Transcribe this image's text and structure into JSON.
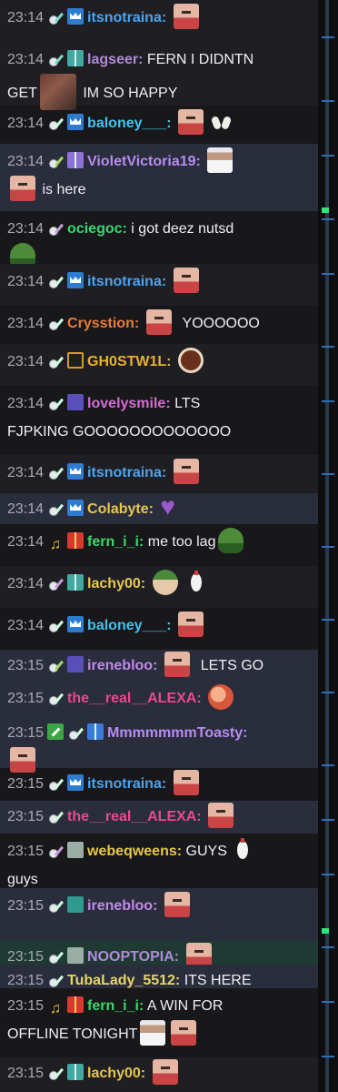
{
  "messages": [
    {
      "time": "23:14",
      "badges": [
        "guitar-teal",
        "crown"
      ],
      "name": "itsnotraina",
      "color": "#4aa3f0",
      "text": "",
      "emotes_after": [
        "face"
      ],
      "style": "alt"
    },
    {
      "time": "23:14",
      "badges": [
        "guitar-teal",
        "gift-teal"
      ],
      "name": "lagseer",
      "color": "#b08bd8",
      "text": "FERN I DIDNTN",
      "line2_pre": "GET",
      "line2_emote": "photo",
      "line2_post": "IM SO HAPPY",
      "style": "alt"
    },
    {
      "time": "23:14",
      "badges": [
        "guitar",
        "crown"
      ],
      "name": "baloney___",
      "color": "#42c2f0",
      "text": "",
      "emotes_after": [
        "face",
        "hands"
      ],
      "style": "plain"
    },
    {
      "time": "23:14",
      "badges": [
        "guitar-green",
        "gift-purple"
      ],
      "name": "VioletVictoria19",
      "color": "#b68cf0",
      "text": "",
      "emotes_after": [
        "person"
      ],
      "line2_emote": "face",
      "line2_post": "is here",
      "style": "hl"
    },
    {
      "time": "23:14",
      "badges": [
        "guitar-purple"
      ],
      "name": "ociegoc",
      "color": "#36d86f",
      "text": "i got deez nutsd",
      "line2_emote": "frog",
      "style": "plain"
    },
    {
      "time": "23:14",
      "badges": [
        "guitar",
        "crown"
      ],
      "name": "itsnotraina",
      "color": "#4aa3f0",
      "text": "",
      "emotes_after": [
        "face"
      ],
      "style": "alt"
    },
    {
      "time": "23:14",
      "badges": [
        "guitar"
      ],
      "name": "Crysstion",
      "color": "#e87a3a",
      "text": "YOOOOOO",
      "emotes_before_text": [
        "face"
      ],
      "style": "plain"
    },
    {
      "time": "23:14",
      "badges": [
        "guitar",
        "tilde"
      ],
      "name": "GH0STW1L",
      "color": "#e6b030",
      "text": "",
      "emotes_after": [
        "cookie"
      ],
      "style": "alt"
    },
    {
      "time": "23:14",
      "badges": [
        "guitar",
        "f-purple"
      ],
      "name": "lovelysmile",
      "color": "#d66bd6",
      "text": "LTS",
      "line2_pre": "FJPKING GOOOOOOOOOOOOO",
      "style": "plain"
    },
    {
      "time": "23:14",
      "badges": [
        "guitar",
        "crown"
      ],
      "name": "itsnotraina",
      "color": "#4aa3f0",
      "text": "",
      "emotes_after": [
        "face"
      ],
      "style": "alt"
    },
    {
      "time": "23:14",
      "badges": [
        "guitar",
        "crown"
      ],
      "name": "Colabyte",
      "color": "#e6c650",
      "text": "",
      "emotes_after": [
        "purpleheart"
      ],
      "style": "hl"
    },
    {
      "time": "23:14",
      "badges": [
        "note",
        "gift-red"
      ],
      "name": "fern_i_i",
      "color": "#3fd46a",
      "text": "me too lag",
      "emotes_after": [
        "frog"
      ],
      "style": "plain"
    },
    {
      "time": "23:14",
      "badges": [
        "guitar-purple",
        "gift-teal"
      ],
      "name": "lachy00",
      "color": "#e6c650",
      "text": "",
      "emotes_after": [
        "knight",
        "chicken"
      ],
      "style": "alt"
    },
    {
      "time": "23:14",
      "badges": [
        "guitar",
        "crown"
      ],
      "name": "baloney___",
      "color": "#42c2f0",
      "text": "",
      "emotes_after": [
        "face"
      ],
      "style": "plain"
    },
    {
      "time": "23:15",
      "badges": [
        "guitar-green",
        "f-purple"
      ],
      "name": "irenebloo",
      "color": "#c08ae8",
      "text": "LETS GO",
      "emotes_before_text": [
        "face"
      ],
      "style": "hl"
    },
    {
      "time": "23:15",
      "badges": [
        "guitar"
      ],
      "name": "the__real__ALEXA",
      "color": "#e84a8a",
      "text": "",
      "emotes_after": [
        "hug"
      ],
      "style": "hl"
    },
    {
      "time": "23:15",
      "badges": [
        "sword",
        "guitar",
        "gift-blue"
      ],
      "name": "MmmmmmmToasty",
      "color": "#b68cf0",
      "text": "",
      "line2_emote": "face",
      "style": "hl"
    },
    {
      "time": "23:15",
      "badges": [
        "guitar",
        "crown"
      ],
      "name": "itsnotraina",
      "color": "#4aa3f0",
      "text": "",
      "emotes_after": [
        "face"
      ],
      "style": "plain"
    },
    {
      "time": "23:15",
      "badges": [
        "guitar"
      ],
      "name": "the__real__ALEXA",
      "color": "#e84a8a",
      "text": "",
      "emotes_after": [
        "face"
      ],
      "style": "hl"
    },
    {
      "time": "23:15",
      "badges": [
        "guitar-purple",
        "cash"
      ],
      "name": "webeqweens",
      "color": "#e6c650",
      "text": "GUYS",
      "emotes_after": [
        "chicken"
      ],
      "line2_pre": "guys",
      "style": "plain"
    },
    {
      "time": "23:15",
      "badges": [
        "guitar",
        "f-teal"
      ],
      "name": "irenebloo",
      "color": "#c08ae8",
      "text": "",
      "emotes_after": [
        "face"
      ],
      "style": "hl"
    },
    {
      "time": "23:15",
      "badges": [
        "guitar",
        "cash"
      ],
      "name": "NOOPTOPIA",
      "color": "#b08bd8",
      "text": "",
      "emotes_after": [
        "face"
      ],
      "style": "sel"
    },
    {
      "time": "23:15",
      "badges": [
        "guitar"
      ],
      "name": "TubaLady_5512",
      "color": "#e6d66a",
      "text": "ITS HERE",
      "style": "hl"
    },
    {
      "time": "23:15",
      "badges": [
        "note",
        "gift-red"
      ],
      "name": "fern_i_i",
      "color": "#3fd46a",
      "text": "A WIN FOR",
      "line2_pre": "OFFLINE TONIGHT",
      "line2_emote": "person",
      "line2_emote2": "face",
      "style": "plain"
    },
    {
      "time": "23:15",
      "badges": [
        "guitar",
        "gift-teal"
      ],
      "name": "lachy00",
      "color": "#e6c650",
      "text": "",
      "emotes_after": [
        "face"
      ],
      "style": "alt"
    }
  ]
}
